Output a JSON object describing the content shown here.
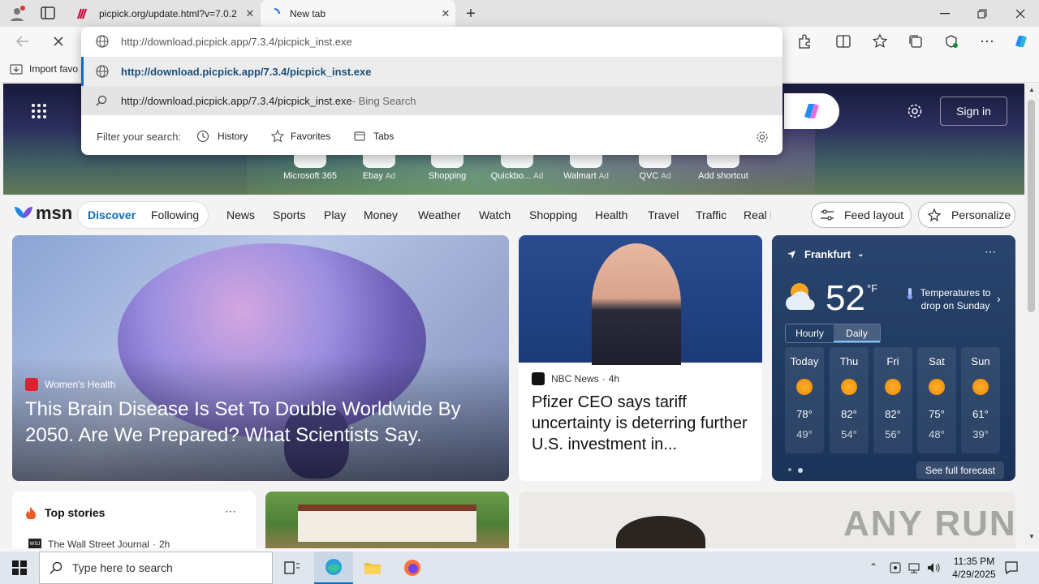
{
  "browser": {
    "tabs": [
      {
        "title": "picpick.org/update.html?v=7.0.2"
      },
      {
        "title": "New tab"
      }
    ],
    "address": {
      "value": "http://download.picpick.app/7.3.4/picpick_inst.exe"
    },
    "suggestions": [
      {
        "text": "http://download.picpick.app/7.3.4/picpick_inst.exe"
      },
      {
        "text": "http://download.picpick.app/7.3.4/picpick_inst.exe",
        "suffix": " - Bing Search"
      }
    ],
    "filter": {
      "label": "Filter your search:",
      "items": [
        "History",
        "Favorites",
        "Tabs"
      ]
    },
    "favorites_bar": {
      "import_label": "Import favo"
    }
  },
  "msn": {
    "sign_in": "Sign in",
    "shortcuts": [
      {
        "label": "Microsoft 365",
        "ad": ""
      },
      {
        "label": "Ebay",
        "ad": "Ad"
      },
      {
        "label": "Shopping",
        "ad": ""
      },
      {
        "label": "Quickbo...",
        "ad": "Ad"
      },
      {
        "label": "Walmart",
        "ad": "Ad"
      },
      {
        "label": "QVC",
        "ad": "Ad"
      },
      {
        "label": "Add shortcut",
        "ad": ""
      }
    ],
    "logo": "msn",
    "nav_pill": [
      "Discover",
      "Following"
    ],
    "nav": [
      "News",
      "Sports",
      "Play",
      "Money",
      "Weather",
      "Watch",
      "Shopping",
      "Health",
      "Travel",
      "Traffic",
      "Real E"
    ],
    "feed_layout": "Feed layout",
    "personalize": "Personalize",
    "main_article": {
      "source": "Women's Health",
      "headline": "This Brain Disease Is Set To Double Worldwide By 2050. Are We Prepared? What Scientists Say."
    },
    "side_article": {
      "source": "NBC News",
      "age": "4h",
      "headline": "Pfizer CEO says tariff uncertainty is deterring further U.S. investment in..."
    },
    "weather": {
      "location": "Frankfurt",
      "temp": "52",
      "unit": "°F",
      "alert": "Temperatures to drop on Sunday",
      "tabs": [
        "Hourly",
        "Daily"
      ],
      "days": [
        {
          "day": "Today",
          "high": "78°",
          "low": "49°"
        },
        {
          "day": "Thu",
          "high": "82°",
          "low": "54°"
        },
        {
          "day": "Fri",
          "high": "82°",
          "low": "56°"
        },
        {
          "day": "Sat",
          "high": "75°",
          "low": "48°"
        },
        {
          "day": "Sun",
          "high": "61°",
          "low": "39°"
        }
      ],
      "forecast_link": "See full forecast"
    },
    "top_stories": {
      "title": "Top stories",
      "source_logo": "WSJ",
      "source": "The Wall Street Journal",
      "age": "2h"
    },
    "watermark": "ANY RUN"
  },
  "taskbar": {
    "search_placeholder": "Type here to search",
    "time": "11:35 PM",
    "date": "4/29/2025"
  }
}
